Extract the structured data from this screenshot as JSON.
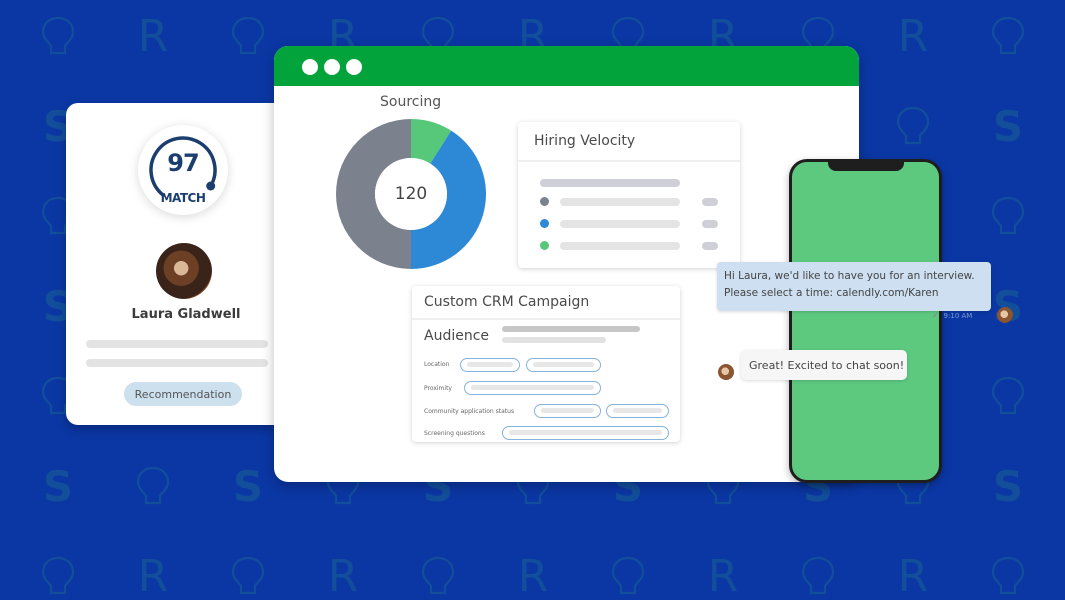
{
  "colors": {
    "background": "#0b37a4",
    "brand_green": "#02a33b",
    "phone_green": "#5cc97f",
    "navy": "#1c3e6e",
    "donut_grey": "#7b828d",
    "donut_blue": "#2d89d6",
    "donut_green": "#57c77a"
  },
  "background_pattern": {
    "glyphs": [
      "S",
      "lightbulb",
      "R"
    ]
  },
  "candidate_card": {
    "match_score": "97",
    "match_label": "MATCH",
    "match_fraction": 0.97,
    "name": "Laura Gladwell",
    "recommendation_label": "Recommendation"
  },
  "browser": {
    "window_dots": 3,
    "sourcing": {
      "title": "Sourcing",
      "center_value": "120"
    },
    "hiring_velocity": {
      "title": "Hiring Velocity",
      "legend": [
        {
          "color": "#7b828d"
        },
        {
          "color": "#2d89d6"
        },
        {
          "color": "#57c77a"
        }
      ]
    },
    "crm_campaign": {
      "title": "Custom CRM Campaign",
      "section": "Audience",
      "fields": [
        {
          "label": "Location"
        },
        {
          "label": "Proximity"
        },
        {
          "label": "Community application status"
        },
        {
          "label": "Screening questions"
        }
      ]
    }
  },
  "chart_data": {
    "type": "pie",
    "title": "Sourcing",
    "center_label": "120",
    "slices": [
      {
        "name": "green",
        "value": 9,
        "color": "#57c77a"
      },
      {
        "name": "blue",
        "value": 41,
        "color": "#2d89d6"
      },
      {
        "name": "grey",
        "value": 50,
        "color": "#7b828d"
      }
    ]
  },
  "chat": {
    "outgoing": {
      "line1": "Hi Laura, we'd like to have you for an interview.",
      "line2": "Please select a time: calendly.com/Karen",
      "time": "9:10 AM"
    },
    "incoming": {
      "text": "Great! Excited to chat soon!"
    }
  }
}
